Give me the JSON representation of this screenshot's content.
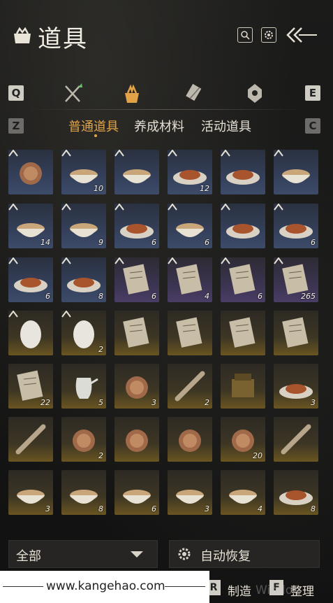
{
  "header": {
    "title": "道具"
  },
  "keys": {
    "left_top": "Q",
    "right_top": "E",
    "left_sub": "Z",
    "right_sub": "C"
  },
  "subtabs": [
    "普通道具",
    "养成材料",
    "活动道具"
  ],
  "grid": {
    "rows": [
      [
        {
          "item": "steamed-bun",
          "count": "",
          "rarity": "blue"
        },
        {
          "item": "noodle-bowl",
          "count": "10",
          "rarity": "blue"
        },
        {
          "item": "noodle-bowl-2",
          "count": "",
          "rarity": "blue"
        },
        {
          "item": "fried-dish",
          "count": "12",
          "rarity": "blue"
        },
        {
          "item": "greens-plate",
          "count": "",
          "rarity": "blue"
        },
        {
          "item": "soup-bowl",
          "count": "",
          "rarity": "blue"
        }
      ],
      [
        {
          "item": "meat-bowl",
          "count": "14",
          "rarity": "blue"
        },
        {
          "item": "clay-pot",
          "count": "9",
          "rarity": "blue"
        },
        {
          "item": "pork-plate",
          "count": "6",
          "rarity": "blue"
        },
        {
          "item": "tofu-dish",
          "count": "6",
          "rarity": "blue"
        },
        {
          "item": "fried-chicken",
          "count": "",
          "rarity": "blue"
        },
        {
          "item": "pastry-plate",
          "count": "6",
          "rarity": "blue"
        }
      ],
      [
        {
          "item": "pancake",
          "count": "6",
          "rarity": "blue"
        },
        {
          "item": "rolls",
          "count": "8",
          "rarity": "blue"
        },
        {
          "item": "scroll-letter",
          "count": "6",
          "rarity": "purple"
        },
        {
          "item": "scroll-letter",
          "count": "4",
          "rarity": "purple"
        },
        {
          "item": "scroll-letter",
          "count": "6",
          "rarity": "purple"
        },
        {
          "item": "scroll-letter",
          "count": "265",
          "rarity": "purple"
        }
      ],
      [
        {
          "item": "purple-egg",
          "count": "",
          "rarity": "gold"
        },
        {
          "item": "white-egg",
          "count": "2",
          "rarity": "gold"
        },
        {
          "item": "letter",
          "count": "",
          "rarity": "gold"
        },
        {
          "item": "letter",
          "count": "",
          "rarity": "gold"
        },
        {
          "item": "letter",
          "count": "",
          "rarity": "gold"
        },
        {
          "item": "book",
          "count": "",
          "rarity": "gold"
        }
      ],
      [
        {
          "item": "book-old",
          "count": "22",
          "rarity": "gold"
        },
        {
          "item": "teapot",
          "count": "5",
          "rarity": "gold"
        },
        {
          "item": "biscuit",
          "count": "3",
          "rarity": "gold"
        },
        {
          "item": "ruler",
          "count": "2",
          "rarity": "gold"
        },
        {
          "item": "bronze-box",
          "count": "",
          "rarity": "gold"
        },
        {
          "item": "mountain-stone",
          "count": "3",
          "rarity": "gold"
        }
      ],
      [
        {
          "item": "scroll-rod",
          "count": "",
          "rarity": "gold"
        },
        {
          "item": "pouch",
          "count": "2",
          "rarity": "gold"
        },
        {
          "item": "jade-pendant",
          "count": "",
          "rarity": "gold"
        },
        {
          "item": "incense-box",
          "count": "",
          "rarity": "gold"
        },
        {
          "item": "comb",
          "count": "20",
          "rarity": "gold"
        },
        {
          "item": "scroll-rod",
          "count": "",
          "rarity": "gold"
        }
      ],
      [
        {
          "item": "porcelain-bowl",
          "count": "3",
          "rarity": "gold"
        },
        {
          "item": "porcelain-bowl",
          "count": "8",
          "rarity": "gold"
        },
        {
          "item": "porcelain-bowl",
          "count": "6",
          "rarity": "gold"
        },
        {
          "item": "porcelain-bowl",
          "count": "3",
          "rarity": "gold"
        },
        {
          "item": "lidded-bowl",
          "count": "4",
          "rarity": "gold"
        },
        {
          "item": "dish",
          "count": "8",
          "rarity": "gold"
        }
      ]
    ]
  },
  "bottom": {
    "filter_value": "全部",
    "auto_label": "自动恢复",
    "key_r": "R",
    "craft_label": "制造",
    "key_f": "F",
    "sort_label": "整理"
  },
  "watermark": {
    "url": "www.kangehao.com",
    "corner": "Windo"
  },
  "colors": {
    "active_tab": "#e2a348",
    "blue_tier": "#34405a",
    "purple_tier": "#4a3d66",
    "gold_tier": "#6a5522"
  }
}
